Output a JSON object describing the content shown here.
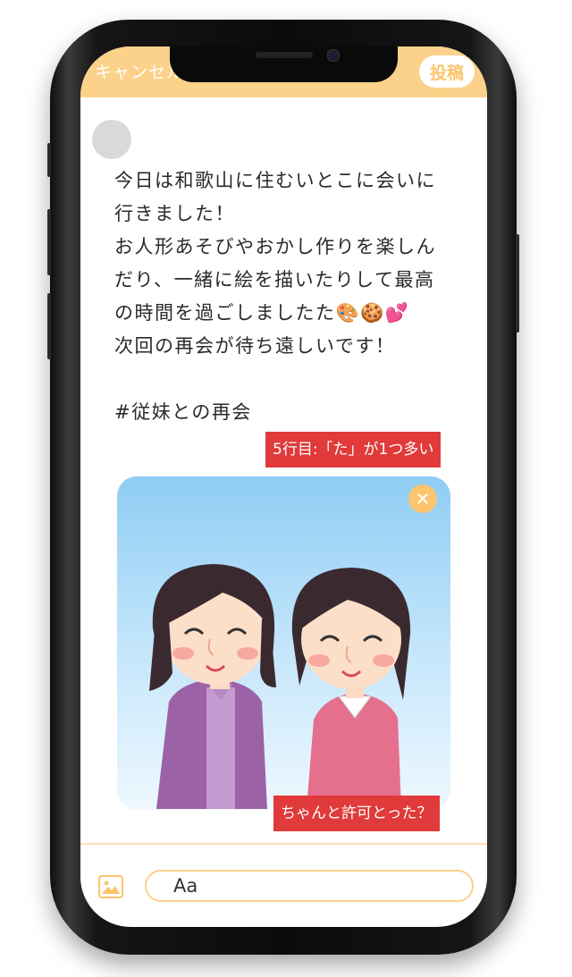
{
  "header": {
    "cancel_label": "キャンセル",
    "post_label": "投稿"
  },
  "post": {
    "text": "今日は和歌山に住むいとこに会いに\n行きました！\nお人形あそびやおかし作りを楽しん\nだり、一緒に絵を描いたりして最高\nの時間を過ごしましたた🎨🍪💕\n次回の再会が待ち遠しいです！\n\n#従妹との再会"
  },
  "annotations": {
    "typo_note": "5行目:「た」が1つ多い",
    "permission_note": "ちゃんと許可とった？"
  },
  "composer": {
    "input_value": "Aa"
  },
  "icons": {
    "close": "close-icon",
    "image": "image-icon"
  },
  "colors": {
    "accent": "#fcc46d",
    "header_bg": "#fcd18a",
    "annotation_bg": "#e03a3a"
  }
}
